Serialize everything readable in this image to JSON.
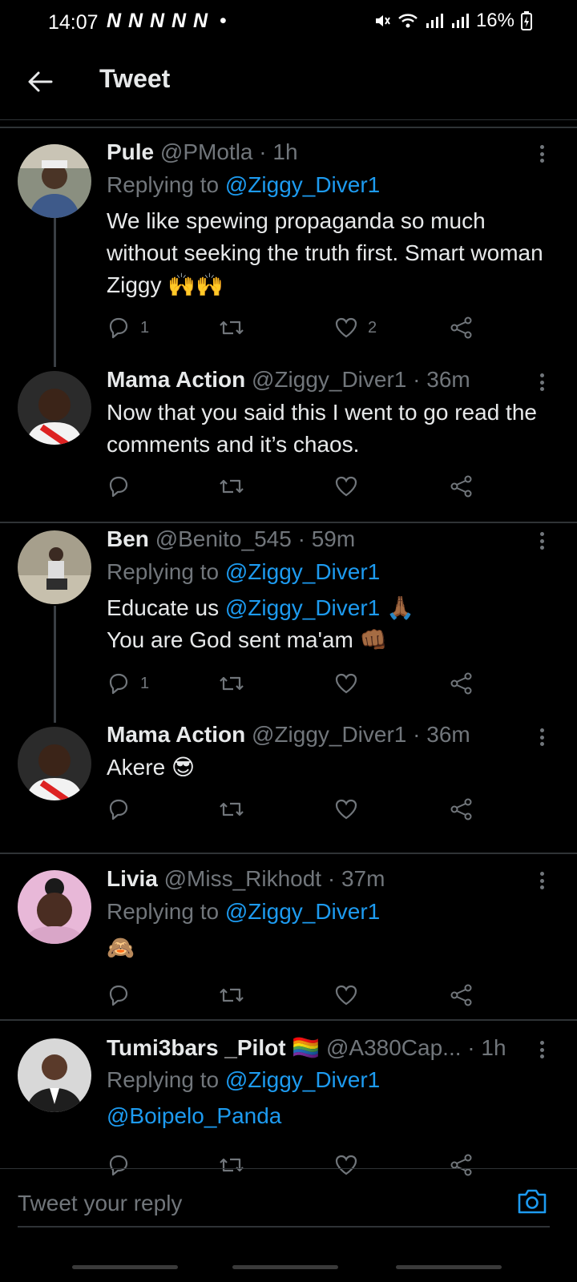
{
  "status_bar": {
    "time": "14:07",
    "notifications": "N N N N N",
    "notif_dot": "•",
    "battery": "16%"
  },
  "header": {
    "title": "Tweet"
  },
  "tweets": [
    {
      "name": "Pule",
      "handle": "@PMotla",
      "time": "1h",
      "replying_label": "Replying to",
      "replying_to": "@Ziggy_Diver1",
      "text": "We like spewing propaganda so much without seeking the truth first. Smart woman Ziggy 🙌🙌",
      "replies": "1",
      "likes": "2"
    },
    {
      "name": "Mama Action",
      "handle": "@Ziggy_Diver1",
      "time": "36m",
      "text": "Now that you said this I went to go read the comments and it’s chaos."
    },
    {
      "name": "Ben",
      "handle": "@Benito_545",
      "time": "59m",
      "replying_label": "Replying to",
      "replying_to": "@Ziggy_Diver1",
      "text_prefix": "Educate us ",
      "text_mention": "@Ziggy_Diver1",
      "text_suffix": " 🙏🏾",
      "text_line2": "You are God sent ma'am 👊🏾",
      "replies": "1"
    },
    {
      "name": "Mama Action",
      "handle": "@Ziggy_Diver1",
      "time": "36m",
      "text": "Akere 😎"
    },
    {
      "name": "Livia",
      "handle": "@Miss_Rikhodt",
      "time": "37m",
      "replying_label": "Replying to",
      "replying_to": "@Ziggy_Diver1",
      "text": "🙈"
    },
    {
      "name": "Tumi3bars _Pilot",
      "flag": "🏳️‍🌈",
      "handle": "@A380Cap...",
      "time": "1h",
      "replying_label": "Replying to",
      "replying_to": "@Ziggy_Diver1",
      "text_mention": "@Boipelo_Panda"
    }
  ],
  "reply_bar": {
    "placeholder": "Tweet your reply"
  },
  "colors": {
    "background": "#000000",
    "text": "#e7e9ea",
    "muted": "#71767b",
    "accent": "#1d9bf0",
    "divider": "#2f3336"
  }
}
